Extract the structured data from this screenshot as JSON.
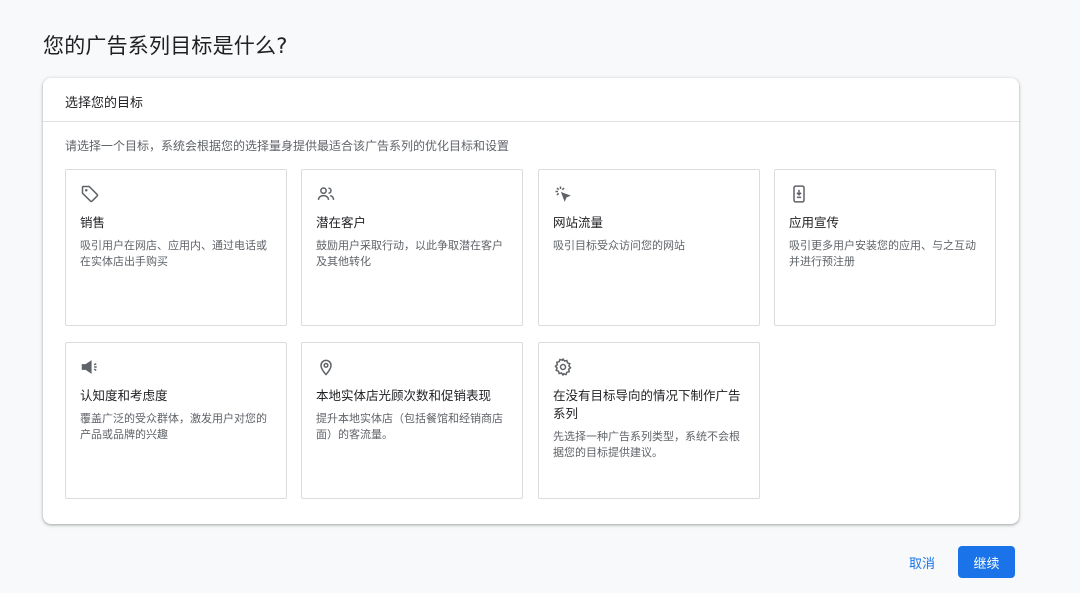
{
  "page": {
    "title": "您的广告系列目标是什么?"
  },
  "panel": {
    "header": "选择您的目标",
    "subtitle": "请选择一个目标，系统会根据您的选择量身提供最适合该广告系列的优化目标和设置"
  },
  "goals": [
    {
      "icon": "tag-icon",
      "title": "销售",
      "description": "吸引用户在网店、应用内、通过电话或在实体店出手购买"
    },
    {
      "icon": "people-icon",
      "title": "潜在客户",
      "description": "鼓励用户采取行动，以此争取潜在客户及其他转化"
    },
    {
      "icon": "cursor-click-icon",
      "title": "网站流量",
      "description": "吸引目标受众访问您的网站"
    },
    {
      "icon": "mobile-download-icon",
      "title": "应用宣传",
      "description": "吸引更多用户安装您的应用、与之互动并进行预注册"
    },
    {
      "icon": "megaphone-icon",
      "title": "认知度和考虑度",
      "description": "覆盖广泛的受众群体，激发用户对您的产品或品牌的兴趣"
    },
    {
      "icon": "location-pin-icon",
      "title": "本地实体店光顾次数和促销表现",
      "description": "提升本地实体店（包括餐馆和经销商店面）的客流量。"
    },
    {
      "icon": "gear-icon",
      "title": "在没有目标导向的情况下制作广告系列",
      "description": "先选择一种广告系列类型，系统不会根据您的目标提供建议。"
    }
  ],
  "footer": {
    "cancel_label": "取消",
    "continue_label": "继续"
  },
  "colors": {
    "accent": "#1a73e8",
    "text_primary": "#202124",
    "text_secondary": "#5f6368",
    "border": "#dadce0"
  }
}
